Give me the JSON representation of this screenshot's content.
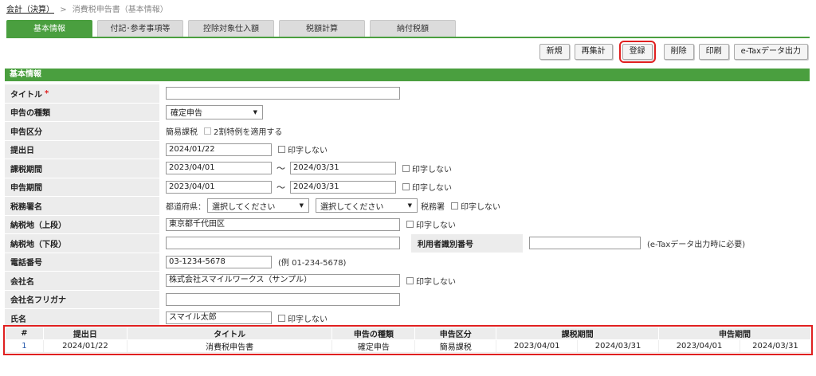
{
  "breadcrumb": {
    "parent": "会計（決算）",
    "separator": ">",
    "current": "消費税申告書（基本情報）"
  },
  "tabs": [
    {
      "label": "基本情報"
    },
    {
      "label": "付記･参考事項等"
    },
    {
      "label": "控除対象仕入額"
    },
    {
      "label": "税額計算"
    },
    {
      "label": "納付税額"
    }
  ],
  "toolbar": {
    "new": "新規",
    "recalc": "再集計",
    "register": "登録",
    "delete": "削除",
    "print": "印刷",
    "etax": "e-Taxデータ出力"
  },
  "section": {
    "title": "基本情報"
  },
  "form": {
    "title": {
      "label": "タイトル",
      "required_mark": "*",
      "value": ""
    },
    "kind": {
      "label": "申告の種類",
      "value": "確定申告"
    },
    "category": {
      "label": "申告区分",
      "value": "簡易課税",
      "checkbox_label": "2割特例を適用する"
    },
    "submit_date": {
      "label": "提出日",
      "value": "2024/01/22",
      "noprint": "印字しない"
    },
    "tax_period": {
      "label": "課税期間",
      "from": "2023/04/01",
      "tilde": "～",
      "to": "2024/03/31",
      "noprint": "印字しない"
    },
    "report_period": {
      "label": "申告期間",
      "from": "2023/04/01",
      "tilde": "～",
      "to": "2024/03/31",
      "noprint": "印字しない"
    },
    "tax_office": {
      "label": "税務署名",
      "pref_label": "都道府県：",
      "pref_value": "選択してください",
      "office_value": "選択してください",
      "suffix": "税務署",
      "noprint": "印字しない"
    },
    "address_upper": {
      "label": "納税地（上段）",
      "value": "東京都千代田区",
      "noprint": "印字しない"
    },
    "address_lower": {
      "label": "納税地（下段）",
      "value": ""
    },
    "user_id": {
      "label": "利用者識別番号",
      "value": "",
      "note": "(e-Taxデータ出力時に必要)"
    },
    "phone": {
      "label": "電話番号",
      "value": "03-1234-5678",
      "example": "(例 01-234-5678)"
    },
    "company": {
      "label": "会社名",
      "value": "株式会社スマイルワークス（サンプル）",
      "noprint": "印字しない"
    },
    "company_kana": {
      "label": "会社名フリガナ",
      "value": ""
    },
    "name": {
      "label": "氏名",
      "value": "スマイル太郎",
      "noprint": "印字しない"
    }
  },
  "table": {
    "headers": [
      "#",
      "提出日",
      "タイトル",
      "申告の種類",
      "申告区分",
      "課税期間",
      "申告期間"
    ],
    "rows": [
      [
        "1",
        "2024/01/22",
        "消費税申告書",
        "確定申告",
        "簡易課税",
        "2023/04/01",
        "2024/03/31",
        "2023/04/01",
        "2024/03/31"
      ]
    ]
  },
  "colors": {
    "accent": "#4a9f3f",
    "highlight": "#e02020",
    "label_bg": "#ececec"
  }
}
